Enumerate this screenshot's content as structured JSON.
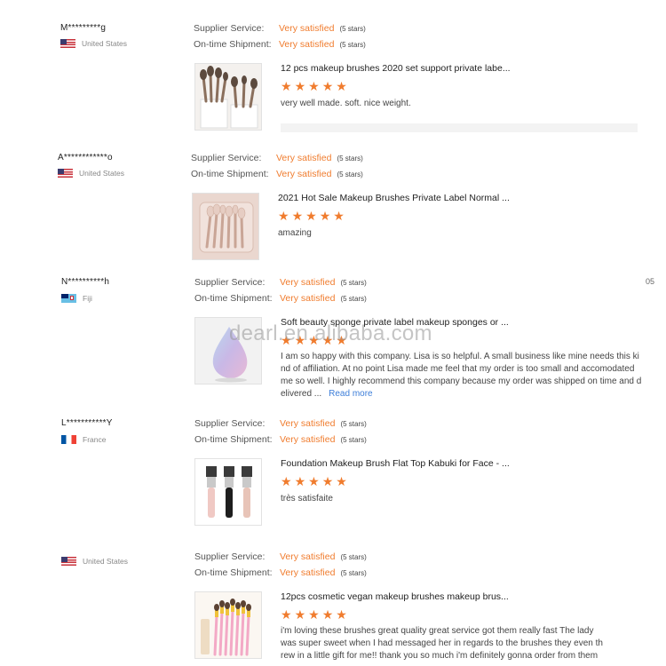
{
  "watermark": "dearl.en.alibaba.com",
  "labels": {
    "supplier_service": "Supplier Service:",
    "on_time_shipment": "On-time Shipment:",
    "read_more": "Read more"
  },
  "edge_text": {
    "date_fragment": "05"
  },
  "colors": {
    "accent_orange": "#f07c2e",
    "link_blue": "#3d7ed9"
  },
  "reviews": [
    {
      "buyer": "M*********g",
      "country": "United States",
      "flag": "us-flag",
      "supplier_service": "Very satisfied",
      "supplier_stars": "(5 stars)",
      "shipment": "Very satisfied",
      "shipment_stars": "(5 stars)",
      "product_title": "12 pcs makeup brushes 2020 set support private labe...",
      "rating": 5,
      "comment": "very well made. soft. nice weight."
    },
    {
      "buyer": "A************o",
      "country": "United States",
      "flag": "us-flag",
      "supplier_service": "Very satisfied",
      "supplier_stars": "(5 stars)",
      "shipment": "Very satisfied",
      "shipment_stars": "(5 stars)",
      "product_title": "2021 Hot Sale Makeup Brushes Private Label Normal ...",
      "rating": 5,
      "comment": "amazing"
    },
    {
      "buyer": "N**********h",
      "country": "Fiji",
      "flag": "fiji-flag",
      "supplier_service": "Very satisfied",
      "supplier_stars": "(5 stars)",
      "shipment": "Very satisfied",
      "shipment_stars": "(5 stars)",
      "product_title": "Soft beauty sponge private label makeup sponges or ...",
      "rating": 5,
      "comment_lines": [
        "I am so happy with this company. Lisa is so helpful. A small business like mine needs this ki",
        "nd of affiliation. At no point Lisa made me feel that my order is too small and accomodated",
        "me so well. I highly recommend this company because my order was shipped on time and d",
        "elivered ..."
      ]
    },
    {
      "buyer": "L***********Y",
      "country": "France",
      "flag": "france-flag",
      "supplier_service": "Very satisfied",
      "supplier_stars": "(5 stars)",
      "shipment": "Very satisfied",
      "shipment_stars": "(5 stars)",
      "product_title": "Foundation Makeup Brush Flat Top Kabuki for Face - ...",
      "rating": 5,
      "comment": "très satisfaite"
    },
    {
      "buyer": "",
      "country": "United States",
      "flag": "us-flag",
      "supplier_service": "Very satisfied",
      "supplier_stars": "(5 stars)",
      "shipment": "Very satisfied",
      "shipment_stars": "(5 stars)",
      "product_title": "12pcs cosmetic vegan makeup brushes makeup brus...",
      "rating": 5,
      "comment_lines": [
        "i'm loving these brushes great quality great service got them really fast  The lady",
        "was super sweet when I had messaged her in regards to the brushes they even th",
        "rew in a little gift for me!! thank you so much i'm definitely gonna order from them"
      ]
    }
  ]
}
